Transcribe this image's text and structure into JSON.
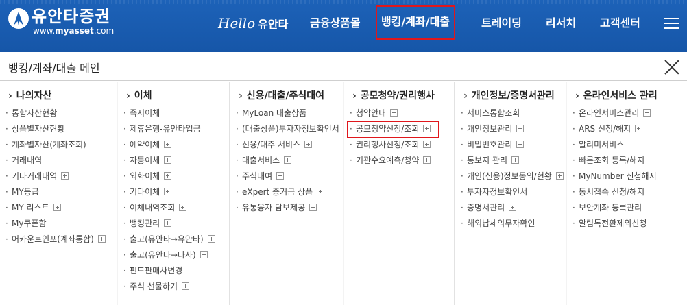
{
  "header": {
    "logo_name": "유안타증권",
    "logo_url_prefix": "www.",
    "logo_url_brand": "myasset",
    "logo_url_suffix": ".com",
    "hello": "Hello",
    "nav": [
      "유안타",
      "금융상품몰",
      "뱅킹/계좌/대출",
      "트레이딩",
      "리서치",
      "고객센터"
    ],
    "active_nav": "뱅킹/계좌/대출",
    "accent_color": "#1a5fb4",
    "highlight_color": "#e0171c"
  },
  "title_bar": {
    "title": "뱅킹/계좌/대출 메인"
  },
  "columns": [
    {
      "heading": "나의자산",
      "items": [
        {
          "label": "통합자산현황",
          "plus": false
        },
        {
          "label": "상품별자산현황",
          "plus": false
        },
        {
          "label": "계좌별자산(계좌조회)",
          "plus": false
        },
        {
          "label": "거래내역",
          "plus": false
        },
        {
          "label": "기타거래내역",
          "plus": true
        },
        {
          "label": "MY등급",
          "plus": false
        },
        {
          "label": "MY 리스트",
          "plus": true
        },
        {
          "label": "My쿠폰함",
          "plus": false
        },
        {
          "label": "어카운트인포(계좌통합)",
          "plus": true
        }
      ]
    },
    {
      "heading": "이체",
      "items": [
        {
          "label": "즉시이체",
          "plus": false
        },
        {
          "label": "제휴은행-유안타입금",
          "plus": false
        },
        {
          "label": "예약이체",
          "plus": true
        },
        {
          "label": "자동이체",
          "plus": true
        },
        {
          "label": "외화이체",
          "plus": true
        },
        {
          "label": "기타이체",
          "plus": true
        },
        {
          "label": "이체내역조회",
          "plus": true
        },
        {
          "label": "뱅킹관리",
          "plus": true
        },
        {
          "label": "출고(유안타→유안타)",
          "plus": true
        },
        {
          "label": "출고(유안타→타사)",
          "plus": true
        },
        {
          "label": "펀드판매사변경",
          "plus": false
        },
        {
          "label": "주식 선물하기",
          "plus": true
        }
      ]
    },
    {
      "heading": "신용/대출/주식대여",
      "items": [
        {
          "label": "MyLoan 대출상품",
          "plus": false
        },
        {
          "label": "(대출상품)투자자정보확인서",
          "plus": false
        },
        {
          "label": "신용/대주 서비스",
          "plus": true
        },
        {
          "label": "대출서비스",
          "plus": true
        },
        {
          "label": "주식대여",
          "plus": true
        },
        {
          "label": "eXpert 증거금 상품",
          "plus": true
        },
        {
          "label": "유통융자 담보제공",
          "plus": true
        }
      ]
    },
    {
      "heading": "공모청약/권리행사",
      "items": [
        {
          "label": "청약안내",
          "plus": true
        },
        {
          "label": "공모청약신청/조회",
          "plus": true
        },
        {
          "label": "권리행사신청/조회",
          "plus": true
        },
        {
          "label": "기관수요예측/청약",
          "plus": true
        }
      ]
    },
    {
      "heading": "개인정보/증명서관리",
      "items": [
        {
          "label": "서비스통합조회",
          "plus": false
        },
        {
          "label": "개인정보관리",
          "plus": true
        },
        {
          "label": "비밀번호관리",
          "plus": true
        },
        {
          "label": "통보지 관리",
          "plus": true
        },
        {
          "label": "개인(신용)정보동의/현황",
          "plus": true
        },
        {
          "label": "투자자정보확인서",
          "plus": false
        },
        {
          "label": "증명서관리",
          "plus": true
        },
        {
          "label": "해외납세의무자확인",
          "plus": false
        }
      ]
    },
    {
      "heading": "온라인서비스 관리",
      "items": [
        {
          "label": "온라인서비스관리",
          "plus": true
        },
        {
          "label": "ARS 신청/해지",
          "plus": true
        },
        {
          "label": "알리미서비스",
          "plus": false
        },
        {
          "label": "빠른조회 등록/해지",
          "plus": false
        },
        {
          "label": "MyNumber 신청해지",
          "plus": false
        },
        {
          "label": "동시접속 신청/해지",
          "plus": false
        },
        {
          "label": "보안계좌 등록관리",
          "plus": false
        },
        {
          "label": "알림톡전환제외신청",
          "plus": false
        }
      ]
    }
  ]
}
